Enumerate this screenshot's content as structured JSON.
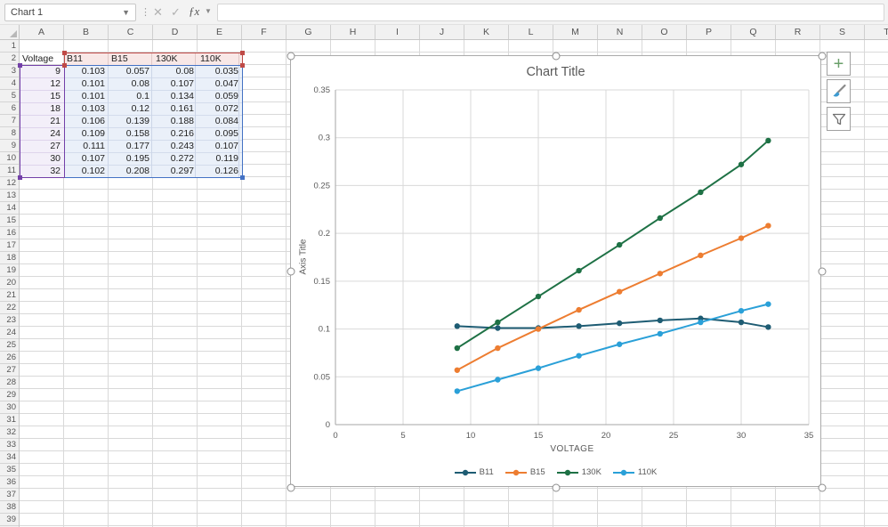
{
  "formula_bar": {
    "name_box_value": "Chart 1",
    "cancel_glyph": "✕",
    "enter_glyph": "✓",
    "fx_glyph": "ƒx",
    "formula_value": ""
  },
  "grid": {
    "columns": [
      "A",
      "B",
      "C",
      "D",
      "E",
      "F",
      "G",
      "H",
      "I",
      "J",
      "K",
      "L",
      "M",
      "N",
      "O",
      "P",
      "Q",
      "R",
      "S",
      "T"
    ],
    "rows": [
      1,
      2,
      3,
      4,
      5,
      6,
      7,
      8,
      9,
      10,
      11,
      12,
      13,
      14,
      15,
      16,
      17,
      18,
      19,
      20,
      21,
      22,
      23,
      24,
      25,
      26,
      27,
      28,
      29,
      30,
      31,
      32,
      33,
      34,
      35,
      36,
      37,
      38,
      39
    ]
  },
  "table": {
    "category_header": "Voltage",
    "series_headers": [
      "B11",
      "B15",
      "130K",
      "110K"
    ],
    "rows": [
      [
        9,
        0.103,
        0.057,
        0.08,
        0.035
      ],
      [
        12,
        0.101,
        0.08,
        0.107,
        0.047
      ],
      [
        15,
        0.101,
        0.1,
        0.134,
        0.059
      ],
      [
        18,
        0.103,
        0.12,
        0.161,
        0.072
      ],
      [
        21,
        0.106,
        0.139,
        0.188,
        0.084
      ],
      [
        24,
        0.109,
        0.158,
        0.216,
        0.095
      ],
      [
        27,
        0.111,
        0.177,
        0.243,
        0.107
      ],
      [
        30,
        0.107,
        0.195,
        0.272,
        0.119
      ],
      [
        32,
        0.102,
        0.208,
        0.297,
        0.126
      ]
    ]
  },
  "chart_data": {
    "type": "line",
    "title": "Chart Title",
    "xlabel": "VOLTAGE",
    "ylabel": "Axis Title",
    "x": [
      9,
      12,
      15,
      18,
      21,
      24,
      27,
      30,
      32
    ],
    "series": [
      {
        "name": "B11",
        "color": "#1e5c73",
        "values": [
          0.103,
          0.101,
          0.101,
          0.103,
          0.106,
          0.109,
          0.111,
          0.107,
          0.102
        ]
      },
      {
        "name": "B15",
        "color": "#ed7d31",
        "values": [
          0.057,
          0.08,
          0.1,
          0.12,
          0.139,
          0.158,
          0.177,
          0.195,
          0.208
        ]
      },
      {
        "name": "130K",
        "color": "#1e7145",
        "values": [
          0.08,
          0.107,
          0.134,
          0.161,
          0.188,
          0.216,
          0.243,
          0.272,
          0.297
        ]
      },
      {
        "name": "110K",
        "color": "#2aa0d8",
        "values": [
          0.035,
          0.047,
          0.059,
          0.072,
          0.084,
          0.095,
          0.107,
          0.119,
          0.126
        ]
      }
    ],
    "xlim": [
      0,
      35
    ],
    "xstep": 5,
    "ylim": [
      0,
      0.35
    ],
    "ystep": 0.05,
    "grid": true,
    "legend_position": "bottom",
    "gridline_color": "#d9d9d9",
    "axis_color": "#a6a6a6",
    "text_color": "#595959"
  },
  "range_colors": {
    "series_names_border": "#bf4a47",
    "values_border": "#4472c4",
    "categories_border": "#7340a8"
  },
  "chart_buttons": {
    "elements_glyph": "+",
    "elements_color": "#6a9f6a"
  }
}
